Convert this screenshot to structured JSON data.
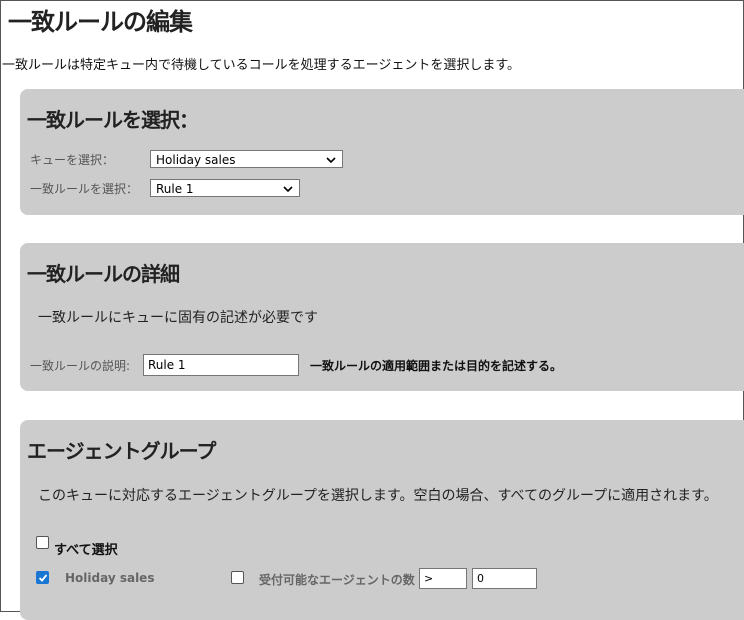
{
  "page": {
    "title": "一致ルールの編集",
    "intro": "一致ルールは特定キュー内で待機しているコールを処理するエージェントを選択します。"
  },
  "select_section": {
    "heading": "一致ルールを選択：",
    "queue_label": "キューを選択：",
    "queue_value": "Holiday sales",
    "rule_label": "一致ルールを選択：",
    "rule_value": "Rule 1"
  },
  "details_section": {
    "heading": "一致ルールの詳細",
    "description": "一致ルールにキューに固有の記述が必要です",
    "desc_label": "一致ルールの説明:",
    "desc_value": "Rule 1",
    "desc_hint": "一致ルールの適用範囲または目的を記述する。"
  },
  "agent_group_section": {
    "heading": "エージェントグループ",
    "description": "このキューに対応するエージェントグループを選択します。空白の場合、すべてのグループに適用されます。",
    "select_all_label": "すべて選択",
    "select_all_checked": false,
    "group_name": "Holiday sales",
    "group_checked": true,
    "available_agents_label": "受付可能なエージェントの数",
    "available_agents_checked": false,
    "operator_value": ">",
    "count_value": "0"
  },
  "colors": {
    "panel_bg": "#cccccc",
    "checkbox_accent": "#1976d2"
  }
}
